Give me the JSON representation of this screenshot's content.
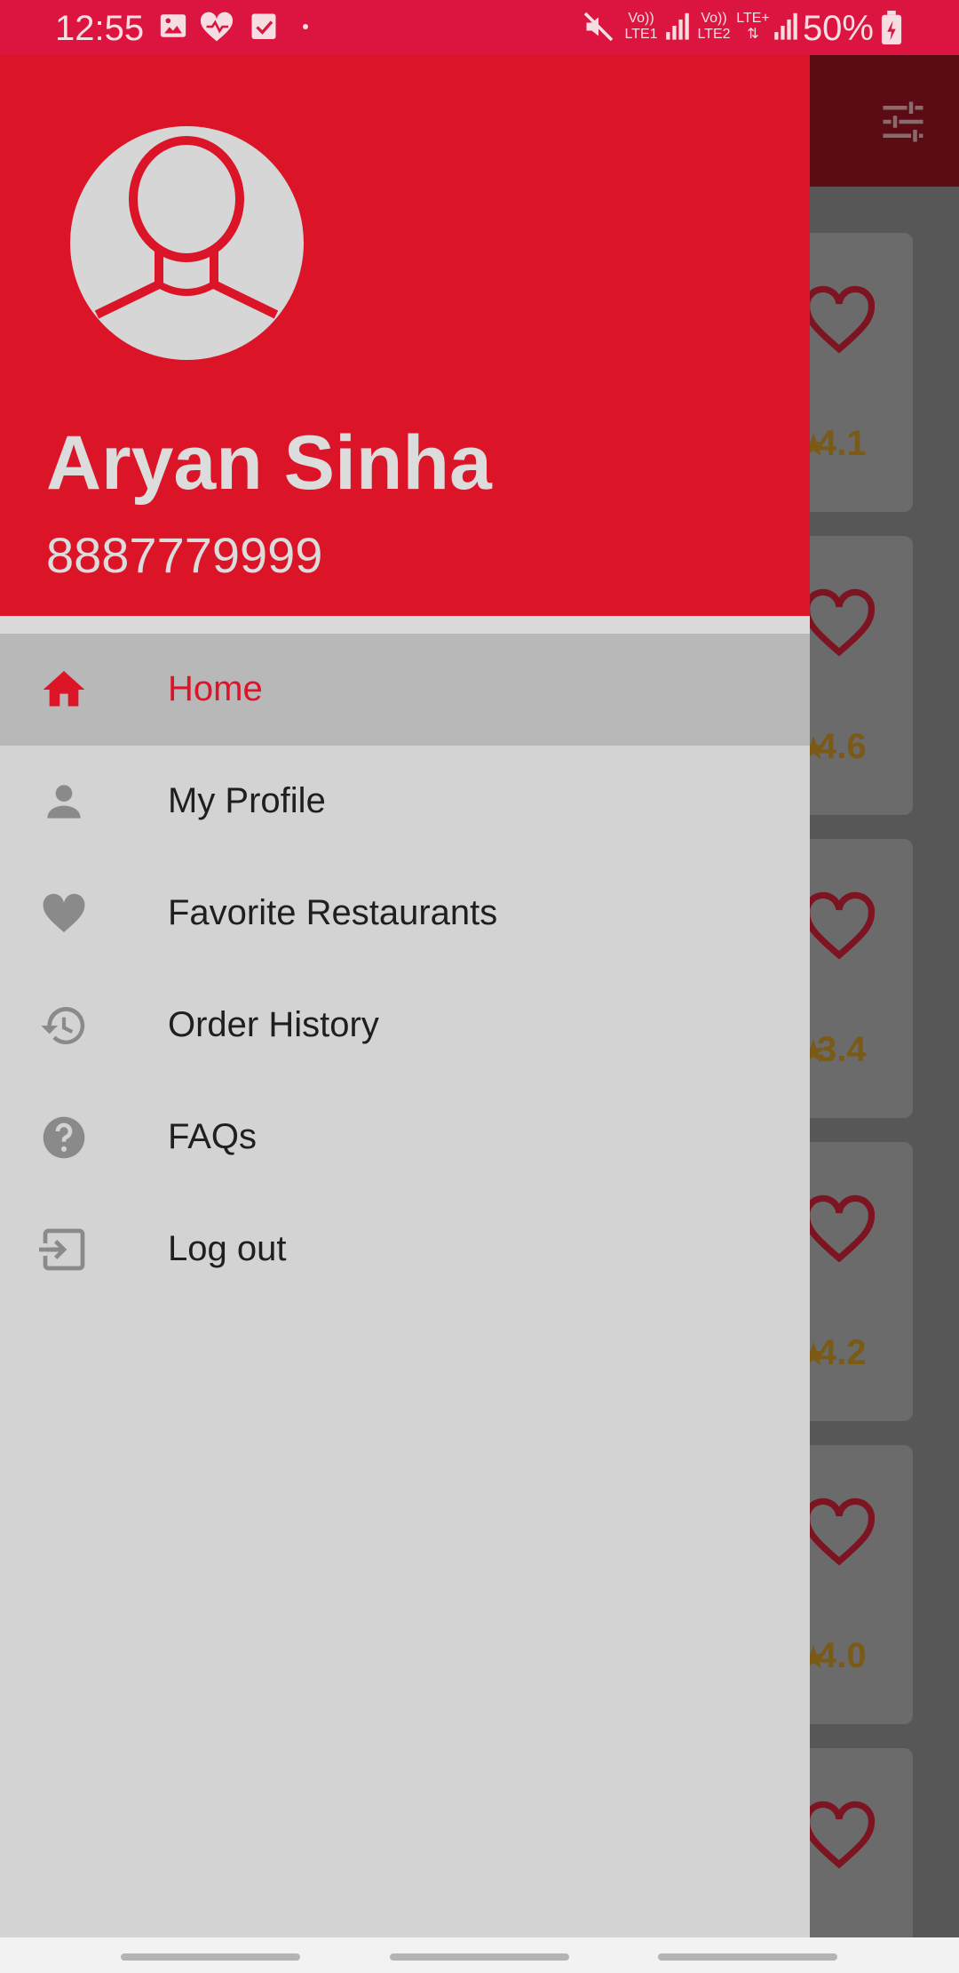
{
  "status_bar": {
    "time": "12:55",
    "battery": "50%",
    "sim1": "LTE1",
    "sim2": "LTE2",
    "network": "LTE+",
    "volte": "Vo))",
    "icons": [
      "image-icon",
      "health-heart-icon",
      "task-check-icon",
      "dot-icon",
      "mute-icon",
      "signal-icon",
      "signal-icon",
      "battery-icon"
    ]
  },
  "drawer": {
    "user_name": "Aryan Sinha",
    "user_phone": "8887779999",
    "menu": [
      {
        "label": "Home",
        "icon": "home-icon",
        "active": true
      },
      {
        "label": "My Profile",
        "icon": "person-icon",
        "active": false
      },
      {
        "label": "Favorite Restaurants",
        "icon": "heart-icon",
        "active": false
      },
      {
        "label": "Order History",
        "icon": "history-icon",
        "active": false
      },
      {
        "label": "FAQs",
        "icon": "help-icon",
        "active": false
      },
      {
        "label": "Log out",
        "icon": "logout-icon",
        "active": false
      }
    ]
  },
  "background_list": {
    "ratings": [
      "4.1",
      "4.6",
      "3.4",
      "4.2",
      "4.0"
    ]
  },
  "colors": {
    "accent": "#dc1428",
    "status_bar": "#dc1440",
    "active_menu_bg": "#b8b8b8"
  }
}
